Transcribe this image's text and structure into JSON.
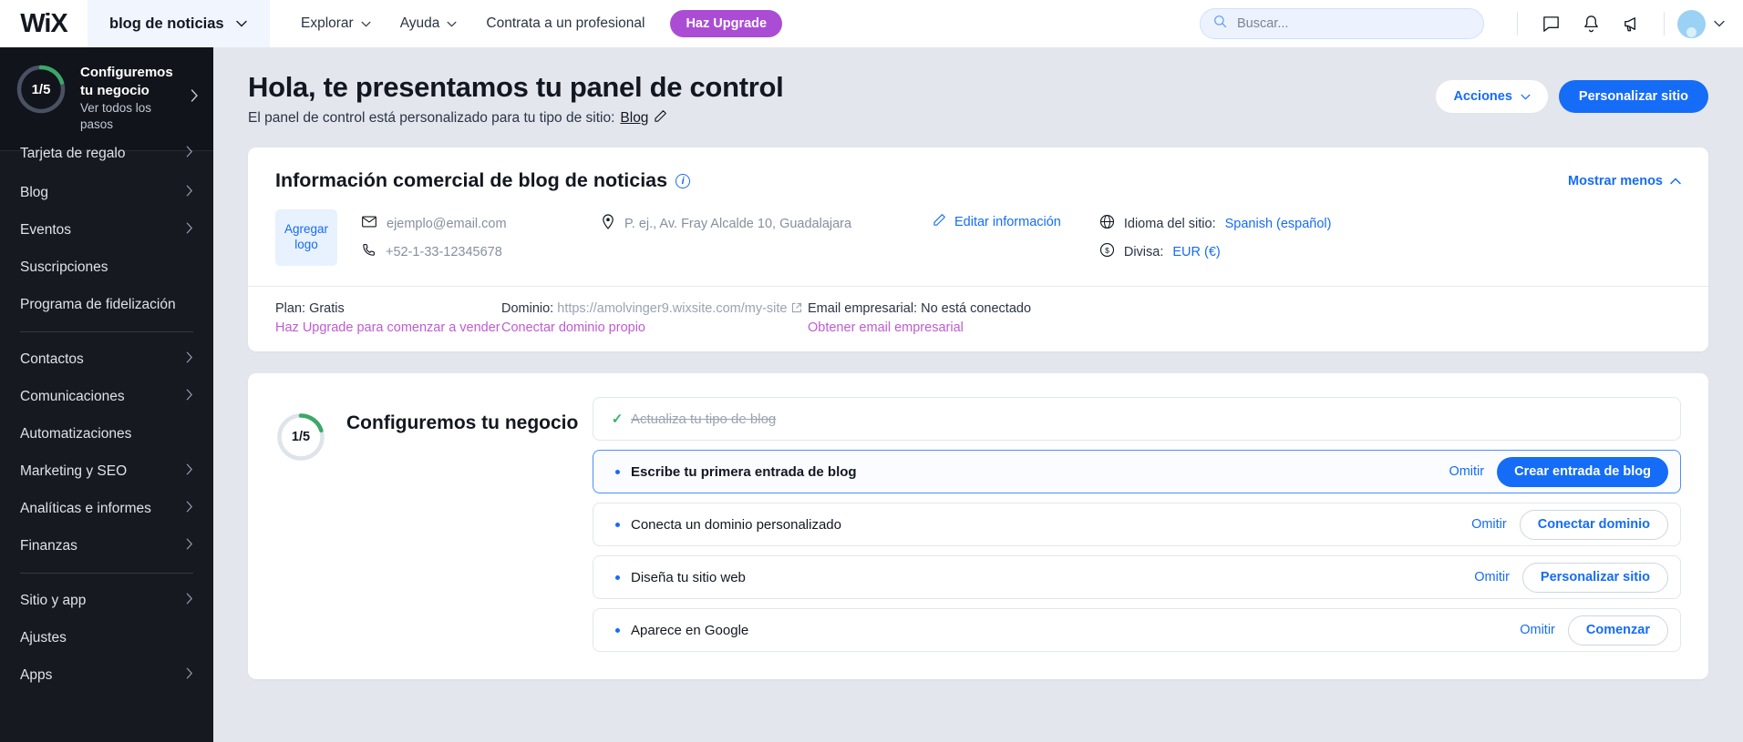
{
  "topbar": {
    "logo": "WiX",
    "site_name": "blog de noticias",
    "nav": [
      {
        "label": "Explorar",
        "caret": true
      },
      {
        "label": "Ayuda",
        "caret": true
      },
      {
        "label": "Contrata a un profesional",
        "caret": false
      }
    ],
    "upgrade_label": "Haz Upgrade",
    "search_placeholder": "Buscar...",
    "search_value": "",
    "icons": [
      "chat-icon",
      "bell-icon",
      "megaphone-icon"
    ]
  },
  "sidebar": {
    "setup": {
      "progress_label": "1/5",
      "progress_value": 1,
      "progress_total": 5,
      "title": "Configuremos tu negocio",
      "subtitle": "Ver todos los pasos"
    },
    "items": [
      {
        "label": "Tarjeta de regalo",
        "chevron": true,
        "clipped": true
      },
      {
        "label": "Blog",
        "chevron": true
      },
      {
        "label": "Eventos",
        "chevron": true
      },
      {
        "label": "Suscripciones",
        "chevron": false
      },
      {
        "label": "Programa de fidelización",
        "chevron": false
      },
      {
        "separator": true
      },
      {
        "label": "Contactos",
        "chevron": true
      },
      {
        "label": "Comunicaciones",
        "chevron": true
      },
      {
        "label": "Automatizaciones",
        "chevron": false
      },
      {
        "label": "Marketing y SEO",
        "chevron": true
      },
      {
        "label": "Analíticas e informes",
        "chevron": true
      },
      {
        "label": "Finanzas",
        "chevron": true
      },
      {
        "separator": true
      },
      {
        "label": "Sitio y app",
        "chevron": true
      },
      {
        "label": "Ajustes",
        "chevron": false
      },
      {
        "label": "Apps",
        "chevron": true
      }
    ]
  },
  "page": {
    "title": "Hola, te presentamos tu panel de control",
    "subtitle_prefix": "El panel de control está personalizado para tu tipo de sitio:",
    "subtitle_link": "Blog",
    "actions_label": "Acciones",
    "customize_label": "Personalizar sitio"
  },
  "business_card": {
    "title": "Información comercial de blog de noticias",
    "info_icon": "i",
    "show_less": "Mostrar menos",
    "logo_placeholder": "Agregar logo",
    "email": "ejemplo@email.com",
    "phone": "+52-1-33-12345678",
    "address": "P. ej., Av. Fray Alcalde 10, Guadalajara",
    "edit_label": "Editar información",
    "language_label": "Idioma del sitio:",
    "language_value": "Spanish (español)",
    "currency_label": "Divisa:",
    "currency_value": "EUR (€)",
    "plan_label": "Plan: Gratis",
    "plan_link": "Haz Upgrade para comenzar a vender",
    "domain_label": "Dominio:",
    "domain_value": "https://amolvinger9.wixsite.com/my-site",
    "domain_link": "Conectar dominio propio",
    "email_biz_label": "Email empresarial: No está conectado",
    "email_biz_link": "Obtener email empresarial"
  },
  "setup_section": {
    "progress_label": "1/5",
    "progress_value": 1,
    "progress_total": 5,
    "title": "Configuremos tu negocio",
    "tasks": [
      {
        "label": "Actualiza tu tipo de blog",
        "state": "done",
        "omit": "",
        "action": ""
      },
      {
        "label": "Escribe tu primera entrada de blog",
        "state": "active",
        "omit": "Omitir",
        "action": "Crear entrada de blog"
      },
      {
        "label": "Conecta un dominio personalizado",
        "state": "todo",
        "omit": "Omitir",
        "action": "Conectar dominio"
      },
      {
        "label": "Diseña tu sitio web",
        "state": "todo",
        "omit": "Omitir",
        "action": "Personalizar sitio"
      },
      {
        "label": "Aparece en Google",
        "state": "todo",
        "omit": "Omitir",
        "action": "Comenzar"
      }
    ]
  },
  "colors": {
    "brand_blue": "#156cf7",
    "upgrade_purple": "#aa4dd4",
    "link_magenta": "#c05bd4",
    "progress_green": "#3ba868",
    "sidebar_bg": "#16191f",
    "page_bg": "#e3e6ed"
  }
}
